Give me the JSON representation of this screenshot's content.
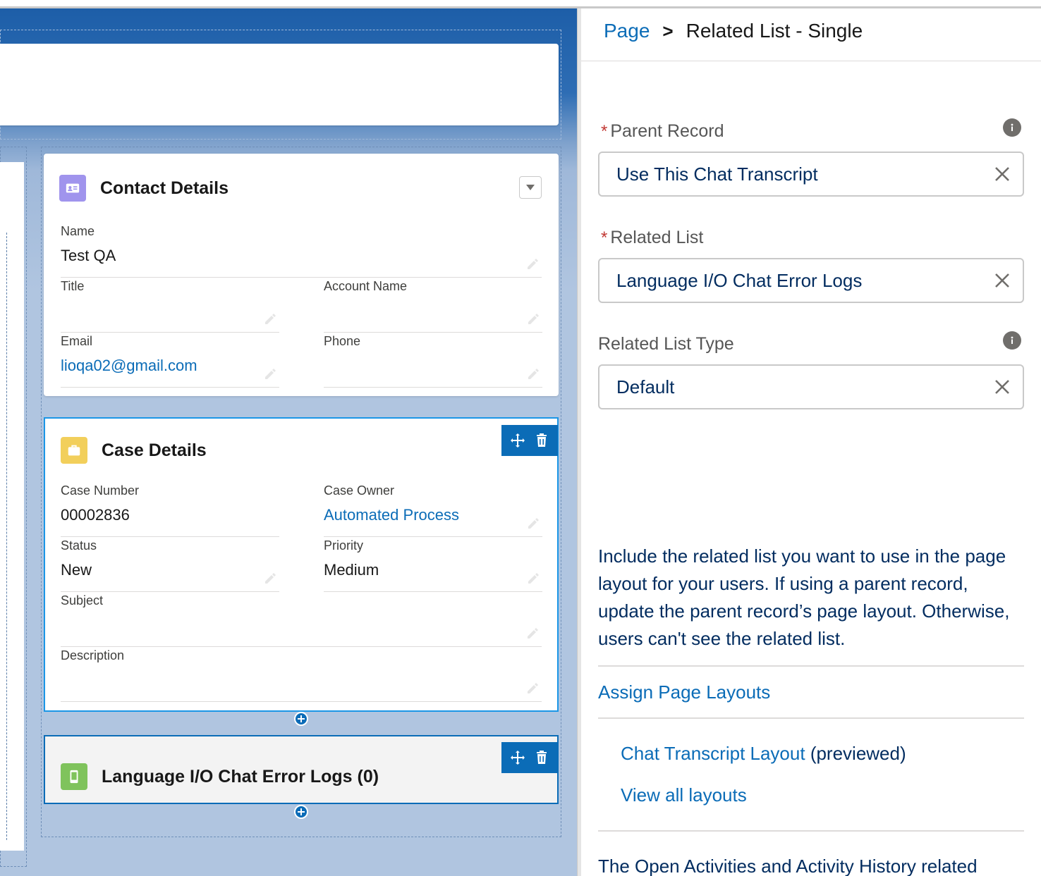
{
  "breadcrumb": {
    "root": "Page",
    "separator": ">",
    "current": "Related List - Single"
  },
  "properties": {
    "parent_record": {
      "label": "Parent Record",
      "value": "Use This Chat Transcript",
      "required": true
    },
    "related_list": {
      "label": "Related List",
      "value": "Language I/O Chat Error Logs",
      "required": true
    },
    "related_list_type": {
      "label": "Related List Type",
      "value": "Default"
    },
    "required_marker": "*",
    "help_text": "Include the related list you want to use in the page layout for your users. If using a parent record, update the parent record’s page layout. Otherwise, users can't see the related list.",
    "assign_layouts_link": "Assign Page Layouts",
    "layout_link": "Chat Transcript Layout",
    "layout_suffix": "(previewed)",
    "view_all_link": "View all layouts",
    "bottom_text": "The Open Activities and Activity History related"
  },
  "contact_card": {
    "title": "Contact Details",
    "fields": {
      "name_label": "Name",
      "name_value": "Test QA",
      "title_label": "Title",
      "title_value": "",
      "account_label": "Account Name",
      "account_value": "",
      "email_label": "Email",
      "email_value": "lioqa02@gmail.com",
      "phone_label": "Phone",
      "phone_value": ""
    }
  },
  "case_card": {
    "title": "Case Details",
    "fields": {
      "number_label": "Case Number",
      "number_value": "00002836",
      "owner_label": "Case Owner",
      "owner_value": "Automated Process",
      "status_label": "Status",
      "status_value": "New",
      "priority_label": "Priority",
      "priority_value": "Medium",
      "subject_label": "Subject",
      "subject_value": "",
      "description_label": "Description",
      "description_value": ""
    }
  },
  "logs_card": {
    "title": "Language I/O Chat Error Logs (0)"
  },
  "icons": {
    "contact": "contact-card-icon",
    "case": "briefcase-icon",
    "logs": "mobile-device-icon",
    "move": "move-icon",
    "delete": "trash-icon",
    "info": "info-icon",
    "clear": "close-icon",
    "edit": "pencil-icon",
    "add": "plus-icon"
  },
  "colors": {
    "accent": "#0b6cb7",
    "selection": "#1b96e6",
    "contact_icon_bg": "#a094ed",
    "case_icon_bg": "#f2cf5b",
    "logs_icon_bg": "#7fc35c",
    "required": "#c23934"
  }
}
